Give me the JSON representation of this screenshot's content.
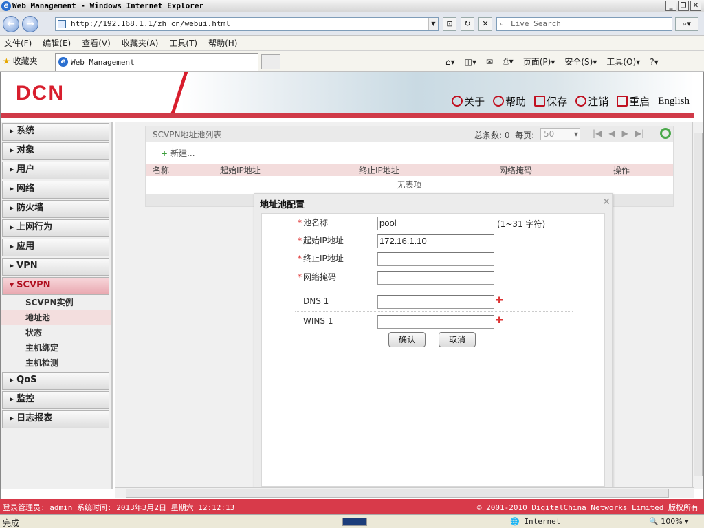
{
  "window": {
    "title": "Web Management - Windows Internet Explorer",
    "url": "http://192.168.1.1/zh_cn/webui.html",
    "search_placeholder": "Live Search",
    "tab_title": "Web Management",
    "favorites": "收藏夹"
  },
  "menubar": [
    "文件(F)",
    "编辑(E)",
    "查看(V)",
    "收藏夹(A)",
    "工具(T)",
    "帮助(H)"
  ],
  "cmdbar": {
    "page": "页面(P)",
    "safety": "安全(S)",
    "tools": "工具(O)"
  },
  "header": {
    "logo": "DCN",
    "links": {
      "about": "关于",
      "help": "帮助",
      "save": "保存",
      "logout": "注销",
      "restart": "重启",
      "english": "English"
    }
  },
  "sidebar": {
    "items": [
      {
        "label": "系统"
      },
      {
        "label": "对象"
      },
      {
        "label": "用户"
      },
      {
        "label": "网络"
      },
      {
        "label": "防火墙"
      },
      {
        "label": "上网行为"
      },
      {
        "label": "应用"
      },
      {
        "label": "VPN"
      },
      {
        "label": "SCVPN"
      }
    ],
    "subitems": [
      {
        "label": "SCVPN实例"
      },
      {
        "label": "地址池"
      },
      {
        "label": "状态"
      },
      {
        "label": "主机绑定"
      },
      {
        "label": "主机检测"
      }
    ],
    "items_after": [
      {
        "label": "QoS"
      },
      {
        "label": "监控"
      },
      {
        "label": "日志报表"
      }
    ]
  },
  "panel": {
    "title": "SCVPN地址池列表",
    "total_label": "总条数: 0",
    "per_page_label": "每页:",
    "per_page_value": "50",
    "new_label": "新建...",
    "columns": {
      "name": "名称",
      "start_ip": "起始IP地址",
      "end_ip": "终止IP地址",
      "mask": "网络掩码",
      "action": "操作"
    },
    "empty_text": "无表项"
  },
  "dialog": {
    "title": "地址池配置",
    "fields": {
      "pool_name": {
        "label": "池名称",
        "value": "pool",
        "hint": "(1~31 字符)"
      },
      "start_ip": {
        "label": "起始IP地址",
        "value": "172.16.1.10"
      },
      "end_ip": {
        "label": "终止IP地址",
        "value": ""
      },
      "netmask": {
        "label": "网络掩码",
        "value": ""
      },
      "dns1": {
        "label": "DNS 1",
        "value": ""
      },
      "wins1": {
        "label": "WINS 1",
        "value": ""
      }
    },
    "ok": "确认",
    "cancel": "取消"
  },
  "appstatus": {
    "left": "登录管理员: admin 系统时间: 2013年3月2日 星期六 12:12:13",
    "right": "© 2001-2010 DigitalChina Networks Limited 版权所有"
  },
  "iestatus": {
    "left": "完成",
    "zone": "Internet",
    "zoom": "100%"
  },
  "colors": {
    "accent": "#d83a4a",
    "brand": "#d81e2d"
  }
}
